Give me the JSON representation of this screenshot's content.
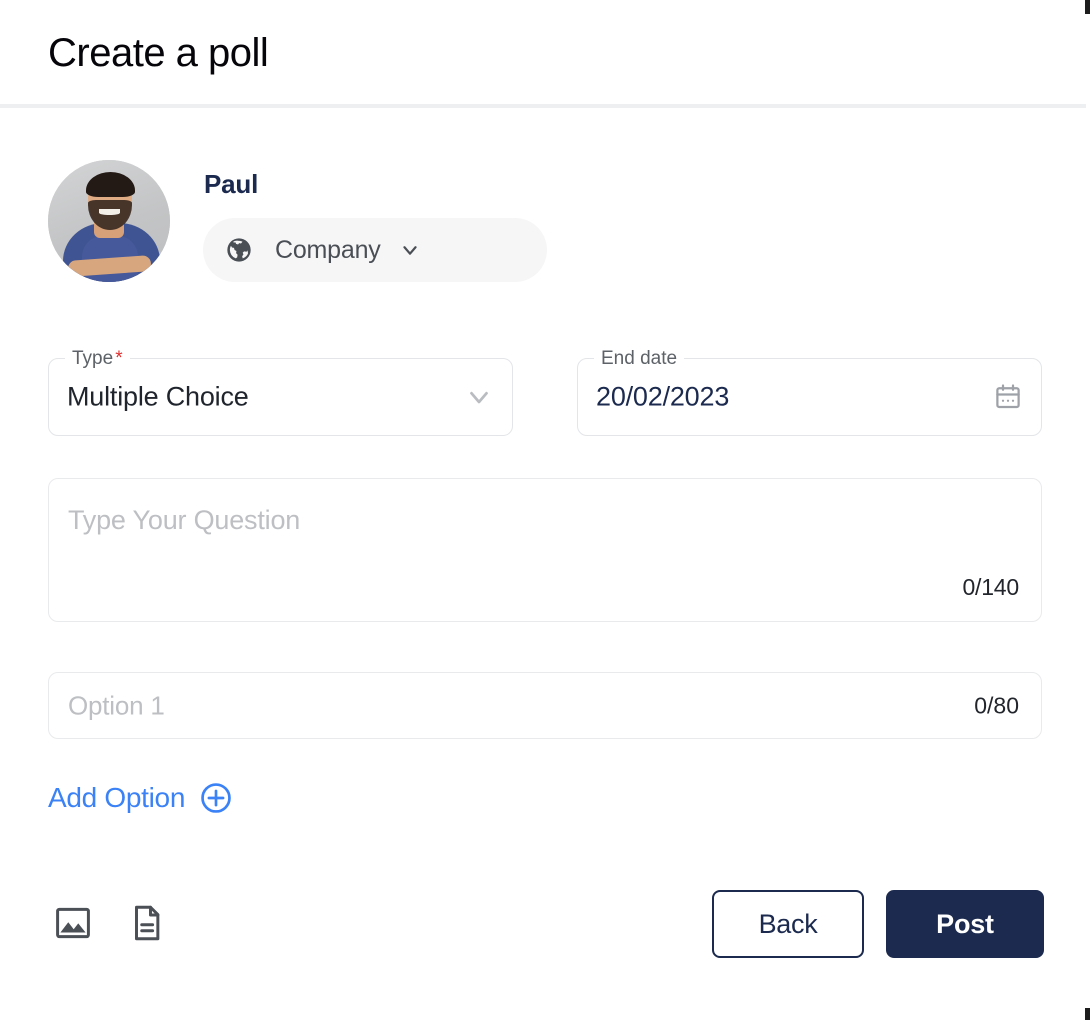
{
  "header": {
    "title": "Create a poll"
  },
  "author": {
    "name": "Paul",
    "avatar_alt": "user-avatar-photo",
    "audience": {
      "label": "Company",
      "globe_icon": "globe-icon",
      "chevron_icon": "chevron-down-icon"
    }
  },
  "form": {
    "type": {
      "label": "Type",
      "required_marker": "*",
      "value": "Multiple Choice",
      "chevron_icon": "chevron-down-icon"
    },
    "end_date": {
      "label": "End date",
      "value": "20/02/2023",
      "calendar_icon": "calendar-icon"
    },
    "question": {
      "placeholder": "Type Your Question",
      "value": "",
      "counter": "0/140",
      "max_length": 140
    },
    "options": [
      {
        "placeholder": "Option 1",
        "value": "",
        "counter": "0/80",
        "max_length": 80
      }
    ],
    "add_option": {
      "label": "Add Option",
      "icon": "plus-circle-icon"
    }
  },
  "footer": {
    "attachments": [
      {
        "name": "image-icon",
        "title": "Add image"
      },
      {
        "name": "document-icon",
        "title": "Add document"
      }
    ],
    "back_label": "Back",
    "post_label": "Post"
  },
  "colors": {
    "navy": "#1b2a4e",
    "accent_blue": "#3b82f6",
    "required_red": "#e03030",
    "field_border": "#e3e5e8",
    "placeholder_gray": "#bdbfc3",
    "pill_bg": "#f6f6f7",
    "divider": "#eeeff1"
  }
}
